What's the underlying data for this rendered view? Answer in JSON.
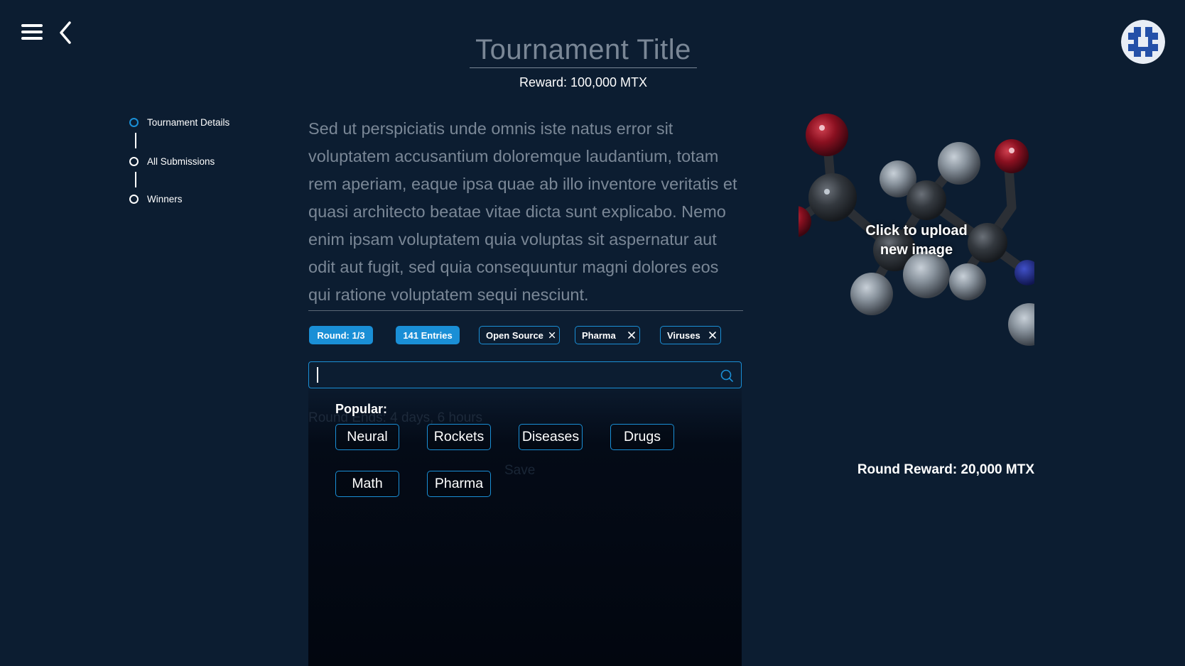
{
  "header": {
    "title": "Tournament Title",
    "reward": "Reward: 100,000 MTX",
    "menu_icon": "hamburger-menu-icon",
    "back_icon": "chevron-left-icon",
    "avatar_icon": "user-avatar-icon"
  },
  "stepper": {
    "items": [
      {
        "label": "Tournament Details",
        "active": true
      },
      {
        "label": "All Submissions",
        "active": false
      },
      {
        "label": "Winners",
        "active": false
      }
    ]
  },
  "description": "Sed ut perspiciatis unde omnis iste natus error sit voluptatem accusantium doloremque laudantium, totam rem aperiam, eaque ipsa quae ab illo inventore veritatis et quasi architecto beatae vitae dicta sunt explicabo. Nemo enim ipsam voluptatem quia voluptas sit aspernatur aut odit aut fugit, sed quia consequuntur magni dolores eos qui ratione voluptatem sequi nesciunt.",
  "chips": {
    "round": "Round: 1/3",
    "entries": "141 Entries",
    "tags": [
      "Open Source",
      "Pharma",
      "Viruses"
    ]
  },
  "search": {
    "value": "",
    "placeholder": "",
    "icon": "search-icon"
  },
  "dropdown": {
    "popular_label": "Popular:",
    "tags": [
      "Neural",
      "Rockets",
      "Diseases",
      "Drugs",
      "Math",
      "Pharma"
    ],
    "ghost_round_text": "Round Ends: 4 days, 6 hours",
    "ghost_save_text": "Save"
  },
  "image_panel": {
    "upload_label_line1": "Click to upload",
    "upload_label_line2": "new image"
  },
  "round_reward": "Round Reward: 20,000 MTX",
  "colors": {
    "background": "#0c1d31",
    "accent": "#1a8fd6",
    "muted_text": "#7a8796",
    "text": "#ffffff"
  }
}
